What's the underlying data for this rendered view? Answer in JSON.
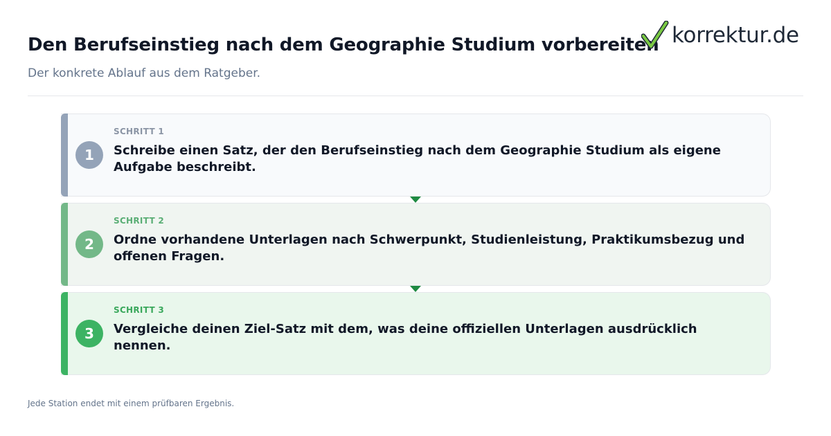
{
  "header": {
    "title": "Den Berufseinstieg nach dem Geographie Studium vorbereiten",
    "subtitle": "Der konkrete Ablauf aus dem Ratgeber."
  },
  "logo": {
    "text": "korrektur.de",
    "icon": "checkmark-icon",
    "check_color": "#7ac943"
  },
  "steps": [
    {
      "number": "1",
      "label": "SCHRITT 1",
      "text": "Schreibe einen Satz, der den Berufseinstieg nach dem Geographie Studium als eigene Aufgabe beschreibt.",
      "color": "#94a3b8"
    },
    {
      "number": "2",
      "label": "SCHRITT 2",
      "text": "Ordne vorhandene Unterlagen nach Schwerpunkt, Studienleistung, Praktikumsbezug und offenen Fragen.",
      "color": "#73b888"
    },
    {
      "number": "3",
      "label": "SCHRITT 3",
      "text": "Vergleiche deinen Ziel-Satz mit dem, was deine offiziellen Unterlagen ausdrücklich nennen.",
      "color": "#3cb363"
    }
  ],
  "connectors": {
    "icon": "arrow-down-icon",
    "color": "#1e8a42"
  },
  "footer": {
    "note": "Jede Station endet mit einem prüfbaren Ergebnis."
  }
}
